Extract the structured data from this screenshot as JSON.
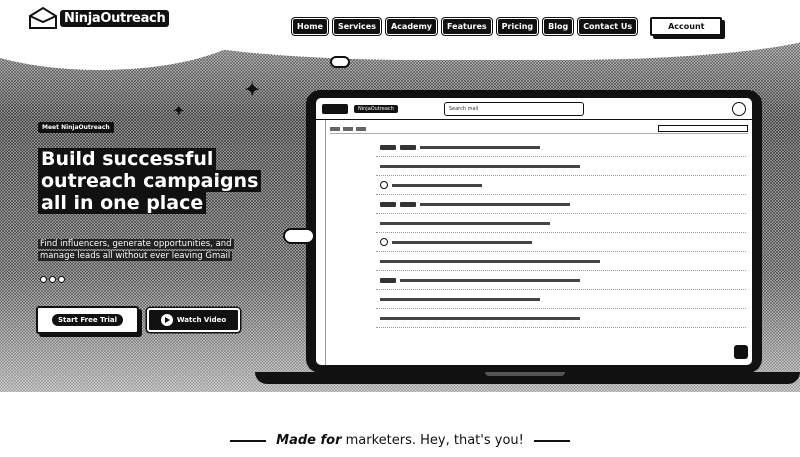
{
  "brand": {
    "name": "NinjaOutreach"
  },
  "nav": {
    "items": [
      "Home",
      "Services",
      "Academy",
      "Features",
      "Pricing",
      "Blog",
      "Contact Us"
    ],
    "account_label": "Account"
  },
  "hero": {
    "badge": "Meet NinjaOutreach",
    "headline_lines": [
      "Build successful",
      "outreach campaigns",
      "all in one place"
    ],
    "subtext_lines": [
      "Find influencers, generate opportunities, and",
      "manage leads all without ever leaving Gmail"
    ],
    "rating_count": 3,
    "cta_primary": "Start Free Trial",
    "cta_video": "Watch Video"
  },
  "laptop": {
    "app_pill": "NinjaOutreach",
    "search_placeholder": "Search mail"
  },
  "tagline": {
    "emphasis": "Made for",
    "rest": " marketers. Hey, that's you!"
  }
}
